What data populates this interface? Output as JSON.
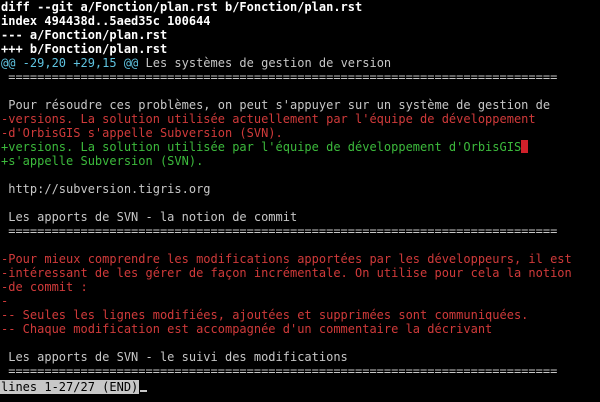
{
  "terminal": {
    "background": "#000000",
    "colors": {
      "header": "#ffffff",
      "hunk": "#5fc3e0",
      "context": "#c7c7c7",
      "deleted": "#d03a3a",
      "added": "#3cba3c",
      "cursor": "#d0202a"
    },
    "lines": [
      {
        "kind": "hdr",
        "text": "diff --git a/Fonction/plan.rst b/Fonction/plan.rst"
      },
      {
        "kind": "hdr",
        "text": "index 494438d..5aed35c 100644"
      },
      {
        "kind": "hdr",
        "text": "--- a/Fonction/plan.rst"
      },
      {
        "kind": "hdr",
        "text": "+++ b/Fonction/plan.rst"
      },
      {
        "kind": "hunk",
        "text": "@@ -29,20 +29,15 @@",
        "suffix": " Les systèmes de gestion de version"
      },
      {
        "kind": "ctx",
        "text": " ============================================================================"
      },
      {
        "kind": "ctx",
        "text": ""
      },
      {
        "kind": "ctx",
        "text": " Pour résoudre ces problèmes, on peut s'appuyer sur un système de gestion de"
      },
      {
        "kind": "del",
        "text": "-versions. La solution utilisée actuellement par l'équipe de développement"
      },
      {
        "kind": "del",
        "text": "-d'OrbisGIS s'appelle Subversion (SVN)."
      },
      {
        "kind": "add",
        "text": "+versions. La solution utilisée par l'équipe de développement d'OrbisGIS",
        "cursor": true
      },
      {
        "kind": "add",
        "text": "+s'appelle Subversion (SVN)."
      },
      {
        "kind": "ctx",
        "text": ""
      },
      {
        "kind": "ctx",
        "text": " http://subversion.tigris.org"
      },
      {
        "kind": "ctx",
        "text": ""
      },
      {
        "kind": "ctx",
        "text": " Les apports de SVN - la notion de commit"
      },
      {
        "kind": "ctx",
        "text": " ============================================================================"
      },
      {
        "kind": "ctx",
        "text": ""
      },
      {
        "kind": "del",
        "text": "-Pour mieux comprendre les modifications apportées par les développeurs, il est"
      },
      {
        "kind": "del",
        "text": "-intéressant de les gérer de façon incrémentale. On utilise pour cela la notion"
      },
      {
        "kind": "del",
        "text": "-de commit :"
      },
      {
        "kind": "del",
        "text": "-"
      },
      {
        "kind": "del",
        "text": "-- Seules les lignes modifiées, ajoutées et supprimées sont communiquées."
      },
      {
        "kind": "del",
        "text": "-- Chaque modification est accompagnée d'un commentaire la décrivant"
      },
      {
        "kind": "ctx",
        "text": ""
      },
      {
        "kind": "ctx",
        "text": " Les apports de SVN - le suivi des modifications"
      },
      {
        "kind": "ctx",
        "text": " ============================================================================"
      }
    ]
  },
  "status_bar": {
    "text": "lines 1-27/27 (END)"
  }
}
